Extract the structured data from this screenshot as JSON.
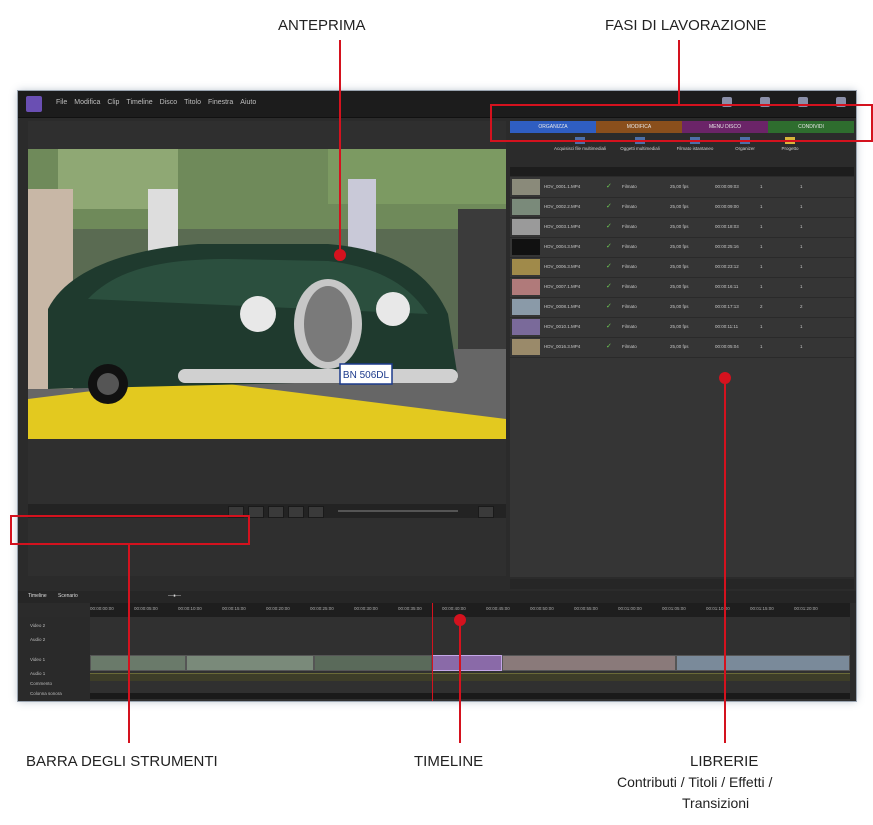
{
  "callouts": {
    "anteprima": "ANTEPRIMA",
    "fasi": "FASI DI LAVORAZIONE",
    "barra": "BARRA DEGLI STRUMENTI",
    "timeline": "TIMELINE",
    "librerie": "LIBRERIE",
    "librerie_sub1": "Contributi / Titoli / Effetti /",
    "librerie_sub2": "Transizioni"
  },
  "app": {
    "menus": [
      "File",
      "Modifica",
      "Clip",
      "Timeline",
      "Disco",
      "Titolo",
      "Finestra",
      "Aiuto"
    ],
    "tabs": [
      {
        "label": "ORGANIZZA",
        "color": "#2f5ec2"
      },
      {
        "label": "MODIFICA",
        "color": "#8a4f1c"
      },
      {
        "label": "MENU DISCO",
        "color": "#6b2468"
      },
      {
        "label": "CONDIVIDI",
        "color": "#2e6d2e"
      }
    ],
    "library_tools": [
      "Acquisisci file multimediali",
      "Oggetti multimediali",
      "Filmato istantaneo",
      "Organizer",
      "Progetto"
    ],
    "library_rows": [
      {
        "name": "HDV_0001.1.MP4",
        "status": "Filmato",
        "fps": "25,00 fps",
        "duration": "00:00:09:03",
        "a": "1",
        "b": "1"
      },
      {
        "name": "HDV_0002.2.MP4",
        "status": "Filmato",
        "fps": "25,00 fps",
        "duration": "00:00:09:00",
        "a": "1",
        "b": "1"
      },
      {
        "name": "HDV_0003.1.MP4",
        "status": "Filmato",
        "fps": "25,00 fps",
        "duration": "00:00:18:03",
        "a": "1",
        "b": "1"
      },
      {
        "name": "HDV_0004.3.MP4",
        "status": "Filmato",
        "fps": "25,00 fps",
        "duration": "00:00:25:16",
        "a": "1",
        "b": "1"
      },
      {
        "name": "HDV_0006.3.MP4",
        "status": "Filmato",
        "fps": "25,00 fps",
        "duration": "00:00:23:12",
        "a": "1",
        "b": "1"
      },
      {
        "name": "HDV_0007.1.MP4",
        "status": "Filmato",
        "fps": "25,00 fps",
        "duration": "00:00:16:11",
        "a": "1",
        "b": "1"
      },
      {
        "name": "HDV_0008.1.MP4",
        "status": "Filmato",
        "fps": "25,00 fps",
        "duration": "00:00:17:13",
        "a": "2",
        "b": "2"
      },
      {
        "name": "HDV_0010.1.MP4",
        "status": "Filmato",
        "fps": "25,00 fps",
        "duration": "00:00:11:11",
        "a": "1",
        "b": "1"
      },
      {
        "name": "HDV_0016.3.MP4",
        "status": "Filmato",
        "fps": "25,00 fps",
        "duration": "00:00:05:04",
        "a": "1",
        "b": "1"
      }
    ],
    "timeline_tabs": [
      "Timeline",
      "Scenario"
    ],
    "ruler": [
      "00:00:00:00",
      "00:00:05:00",
      "00:00:10:00",
      "00:00:15:00",
      "00:00:20:00",
      "00:00:25:00",
      "00:00:30:00",
      "00:00:35:00",
      "00:00:40:00",
      "00:00:45:00",
      "00:00:50:00",
      "00:00:55:00",
      "00:01:00:00",
      "00:01:05:00",
      "00:01:10:00",
      "00:01:15:00",
      "00:01:20:00",
      "00:01:25:00"
    ],
    "tracks": [
      "Video 2",
      "Audio 2",
      "Video 1",
      "Audio 1",
      "Commento",
      "Colonna sonora"
    ],
    "plate": "BN 506DL"
  }
}
